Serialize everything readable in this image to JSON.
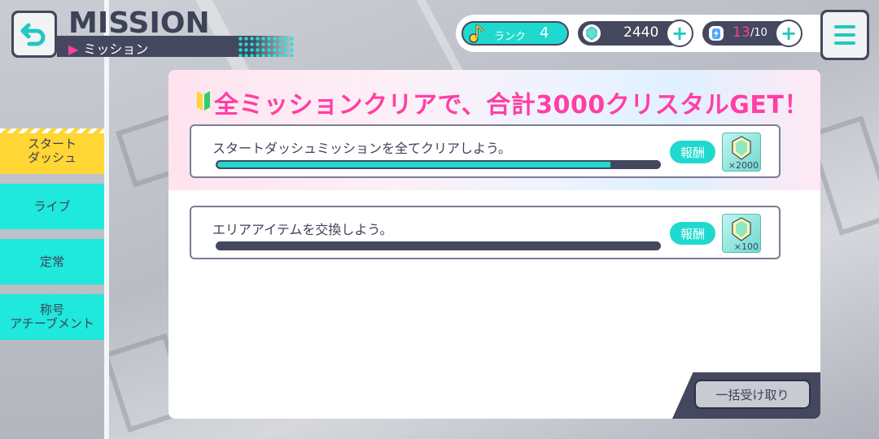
{
  "header": {
    "title_en": "MISSION",
    "title_jp": "ミッション",
    "back_icon": "back-arrow-icon"
  },
  "status": {
    "rank_label": "ランク",
    "rank_value": "4",
    "crystals": "2440",
    "energy_current": "13",
    "energy_max": "/10"
  },
  "sidebar": {
    "tabs": [
      {
        "label": "スタート\nダッシュ",
        "active": true
      },
      {
        "label": "ライブ",
        "active": false
      },
      {
        "label": "定常",
        "active": false
      },
      {
        "label": "称号\nアチーブメント",
        "active": false
      }
    ]
  },
  "banner": {
    "title": "全ミッションクリアで、合計3000クリスタルGET！"
  },
  "missions": [
    {
      "text": "スタートダッシュミッションを全てクリアしよう。",
      "progress": 0.89,
      "reward_label": "報酬",
      "reward_qty": "×2000"
    },
    {
      "text": "エリアアイテムを交換しよう。",
      "progress": 0.0,
      "reward_label": "報酬",
      "reward_qty": "×100"
    }
  ],
  "actions": {
    "claim_all": "一括受け取り"
  },
  "colors": {
    "accent": "#1fd9cf",
    "active_tab": "#ffd633",
    "dark": "#44485e",
    "pink": "#ff3fa4"
  }
}
